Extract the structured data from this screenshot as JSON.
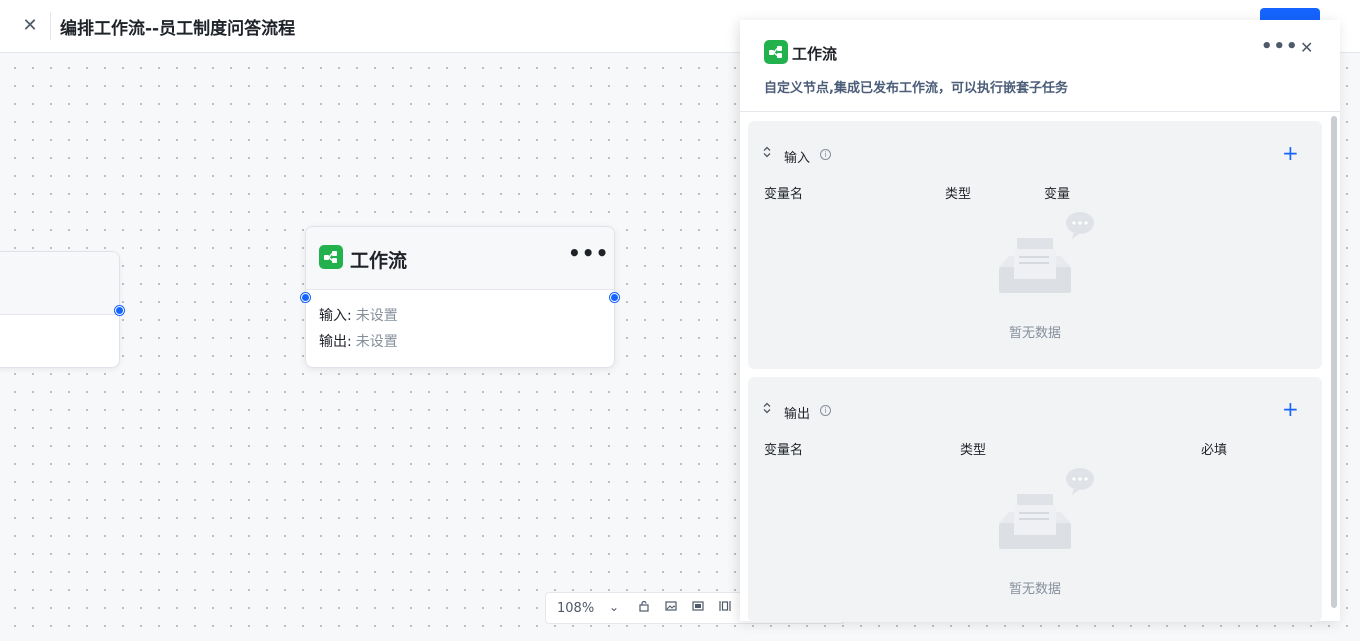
{
  "header": {
    "close_glyph": "✕",
    "title": "编排工作流--员工制度问答流程"
  },
  "node": {
    "title": "工作流",
    "more": "•••",
    "input_label": "输入:",
    "input_value": "未设置",
    "output_label": "输出:",
    "output_value": "未设置"
  },
  "zoom": {
    "value": "108%",
    "caret": "⌄"
  },
  "panel": {
    "title": "工作流",
    "more": "•••",
    "close_glyph": "✕",
    "description": "自定义节点,集成已发布工作流，可以执行嵌套子任务",
    "input_section": {
      "title": "输入",
      "add": "+",
      "columns": [
        "变量名",
        "类型",
        "变量"
      ],
      "empty_text": "暂无数据"
    },
    "output_section": {
      "title": "输出",
      "add": "+",
      "columns": [
        "变量名",
        "类型",
        "必填"
      ],
      "empty_text": "暂无数据"
    }
  },
  "colors": {
    "accent": "#1664ff",
    "node_icon": "#22b14c"
  },
  "icons": [
    "close-icon",
    "workflow-icon",
    "more-icon",
    "info-icon",
    "add-icon",
    "chevron-updown-icon",
    "empty-data-icon",
    "lock-icon",
    "image-icon",
    "fit-view-icon",
    "layout-icon"
  ]
}
